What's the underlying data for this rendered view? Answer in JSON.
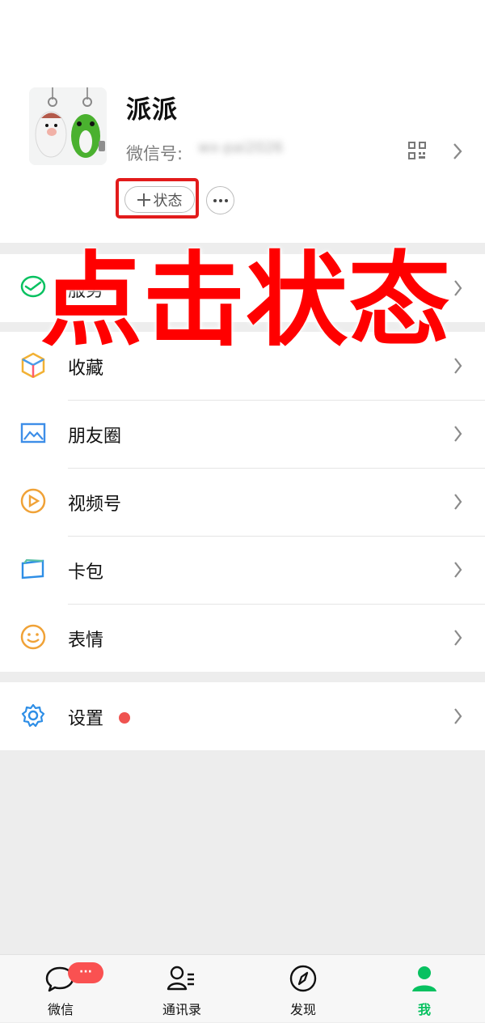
{
  "profile": {
    "nickname": "派派",
    "wechat_id_label": "微信号:",
    "wechat_id_value": "wx-pai2026",
    "status_label": "状态",
    "more_label": "···"
  },
  "overlay_text": "点击状态",
  "menu": {
    "service": {
      "label": "服务",
      "icon": "wallet-icon"
    },
    "items": [
      {
        "label": "收藏",
        "icon": "favorites-cube-icon"
      },
      {
        "label": "朋友圈",
        "icon": "moments-picture-icon"
      },
      {
        "label": "视频号",
        "icon": "channels-play-icon"
      },
      {
        "label": "卡包",
        "icon": "card-pack-icon"
      },
      {
        "label": "表情",
        "icon": "sticker-smile-icon"
      }
    ],
    "settings": {
      "label": "设置",
      "icon": "gear-icon",
      "has_red_dot": true
    }
  },
  "tabbar": [
    {
      "label": "微信",
      "icon": "chat-bubble-icon",
      "badge": "···"
    },
    {
      "label": "通讯录",
      "icon": "contacts-icon"
    },
    {
      "label": "发现",
      "icon": "compass-icon"
    },
    {
      "label": "我",
      "icon": "person-icon",
      "active": true
    }
  ],
  "colors": {
    "wechat_green": "#07c160",
    "overlay_red": "#ff0000",
    "badge_red": "#fa5151"
  }
}
